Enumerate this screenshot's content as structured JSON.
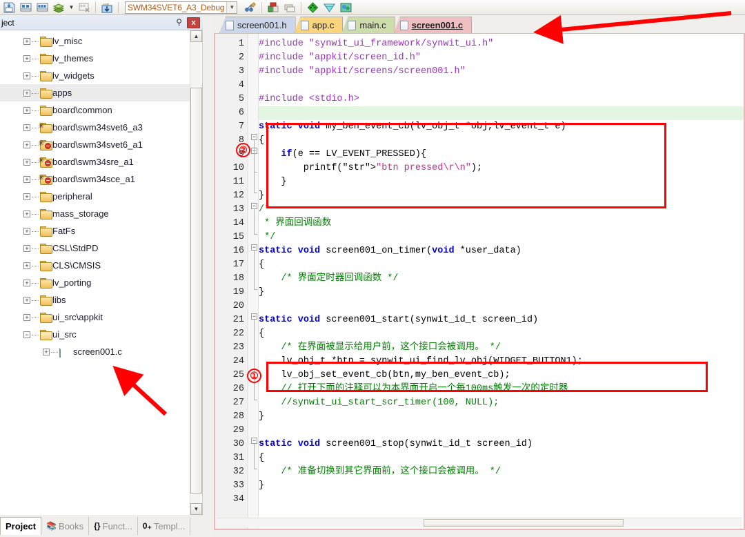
{
  "toolbar": {
    "icons": [
      "save-all-icon",
      "insert-bookmark-icon",
      "next-bookmark-icon",
      "layers-icon",
      "clear-bookmarks-icon",
      "debug-icon",
      "target-options-icon",
      "manage-components-icon",
      "pack-installer-icon",
      "configuration-wizard-icon",
      "events-viewer-icon"
    ],
    "config_value": "SWM34SVET6_A3_Debug",
    "dropdown_icon": "chevron-down-icon"
  },
  "left_panel": {
    "title": "ject",
    "pin_icon": "pin-icon",
    "close_label": "x",
    "scroll_up_icon": "▲",
    "scroll_down_icon": "▼",
    "tree": [
      {
        "label": "lv_misc",
        "type": "folder",
        "expander": "+",
        "depth": 0,
        "selected": false,
        "badge": "none"
      },
      {
        "label": "lv_themes",
        "type": "folder",
        "expander": "+",
        "depth": 0,
        "selected": false,
        "badge": "none"
      },
      {
        "label": "lv_widgets",
        "type": "folder",
        "expander": "+",
        "depth": 0,
        "selected": false,
        "badge": "none"
      },
      {
        "label": "apps",
        "type": "folder",
        "expander": "+",
        "depth": 0,
        "selected": true,
        "badge": "none"
      },
      {
        "label": "board\\common",
        "type": "folder",
        "expander": "+",
        "depth": 0,
        "selected": false,
        "badge": "none"
      },
      {
        "label": "board\\swm34svet6_a3",
        "type": "folder",
        "expander": "+",
        "depth": 0,
        "selected": false,
        "badge": "gear"
      },
      {
        "label": "board\\swm34svet6_a1",
        "type": "folder",
        "expander": "+",
        "depth": 0,
        "selected": false,
        "badge": "gear-excluded"
      },
      {
        "label": "board\\swm34sre_a1",
        "type": "folder",
        "expander": "+",
        "depth": 0,
        "selected": false,
        "badge": "gear-excluded"
      },
      {
        "label": "board\\swm34sce_a1",
        "type": "folder",
        "expander": "+",
        "depth": 0,
        "selected": false,
        "badge": "gear-excluded"
      },
      {
        "label": "peripheral",
        "type": "folder",
        "expander": "+",
        "depth": 0,
        "selected": false,
        "badge": "none"
      },
      {
        "label": "mass_storage",
        "type": "folder",
        "expander": "+",
        "depth": 0,
        "selected": false,
        "badge": "none"
      },
      {
        "label": "FatFs",
        "type": "folder",
        "expander": "+",
        "depth": 0,
        "selected": false,
        "badge": "none"
      },
      {
        "label": "CSL\\StdPD",
        "type": "folder",
        "expander": "+",
        "depth": 0,
        "selected": false,
        "badge": "none"
      },
      {
        "label": "CLS\\CMSIS",
        "type": "folder",
        "expander": "+",
        "depth": 0,
        "selected": false,
        "badge": "none"
      },
      {
        "label": "lv_porting",
        "type": "folder",
        "expander": "+",
        "depth": 0,
        "selected": false,
        "badge": "none"
      },
      {
        "label": "libs",
        "type": "folder",
        "expander": "+",
        "depth": 0,
        "selected": false,
        "badge": "none"
      },
      {
        "label": "ui_src\\appkit",
        "type": "folder",
        "expander": "+",
        "depth": 0,
        "selected": false,
        "badge": "none"
      },
      {
        "label": "ui_src",
        "type": "folder-open",
        "expander": "−",
        "depth": 0,
        "selected": false,
        "badge": "none"
      },
      {
        "label": "screen001.c",
        "type": "file",
        "expander": "+",
        "depth": 1,
        "selected": false,
        "badge": "none"
      }
    ]
  },
  "bottom_tabs": [
    {
      "label": "Project",
      "icon": "",
      "active": true
    },
    {
      "label": "Books",
      "icon": "books-icon",
      "active": false
    },
    {
      "label": "Funct...",
      "icon": "{}",
      "active": false
    },
    {
      "label": "Templ...",
      "icon": "0+",
      "active": false
    }
  ],
  "editor": {
    "file_tabs": [
      {
        "label": "screen001.h",
        "color": "#ccd6ea",
        "active": false
      },
      {
        "label": "app.c",
        "color": "#fbd57e",
        "active": false
      },
      {
        "label": "main.c",
        "color": "#cddcab",
        "active": false
      },
      {
        "label": "screen001.c",
        "color": "#f0bfc2",
        "active": true
      }
    ],
    "code_lines": [
      {
        "n": 1,
        "text": "#include \"synwit_ui_framework/synwit_ui.h\"",
        "style": "pp"
      },
      {
        "n": 2,
        "text": "#include \"appkit/screen_id.h\"",
        "style": "pp"
      },
      {
        "n": 3,
        "text": "#include \"appkit/screens/screen001.h\"",
        "style": "pp"
      },
      {
        "n": 4,
        "text": "",
        "style": "plain"
      },
      {
        "n": 5,
        "text": "#include <stdio.h>",
        "style": "pp"
      },
      {
        "n": 6,
        "text": "",
        "style": "plain",
        "highlight": true
      },
      {
        "n": 7,
        "text": "static void my_ben_event_cb(lv_obj_t *obj,lv_event_t e)",
        "style": "mixed-decl"
      },
      {
        "n": 8,
        "text": "{",
        "style": "plain"
      },
      {
        "n": 9,
        "text": "    if(e == LV_EVENT_PRESSED){",
        "style": "mixed-if"
      },
      {
        "n": 10,
        "text": "        printf(\"btn pressed\\r\\n\");",
        "style": "mixed-printf"
      },
      {
        "n": 11,
        "text": "    }",
        "style": "plain"
      },
      {
        "n": 12,
        "text": "}",
        "style": "plain"
      },
      {
        "n": 13,
        "text": "/*",
        "style": "cmt"
      },
      {
        "n": 14,
        "text": " * 界面回调函数",
        "style": "cmt"
      },
      {
        "n": 15,
        "text": " */",
        "style": "cmt"
      },
      {
        "n": 16,
        "text": "static void screen001_on_timer(void *user_data)",
        "style": "mixed-timer"
      },
      {
        "n": 17,
        "text": "{",
        "style": "plain"
      },
      {
        "n": 18,
        "text": "    /* 界面定时器回调函数 */",
        "style": "cmt"
      },
      {
        "n": 19,
        "text": "}",
        "style": "plain"
      },
      {
        "n": 20,
        "text": "",
        "style": "plain"
      },
      {
        "n": 21,
        "text": "static void screen001_start(synwit_id_t screen_id)",
        "style": "mixed-start"
      },
      {
        "n": 22,
        "text": "{",
        "style": "plain"
      },
      {
        "n": 23,
        "text": "    /* 在界面被显示给用户前，这个接口会被调用。 */",
        "style": "cmt"
      },
      {
        "n": 24,
        "text": "    lv_obj_t *btn = synwit_ui_find_lv_obj(WIDGET_BUTTON1);",
        "style": "plain"
      },
      {
        "n": 25,
        "text": "    lv_obj_set_event_cb(btn,my_ben_event_cb);",
        "style": "plain"
      },
      {
        "n": 26,
        "text": "    // 打开下面的注释可以为本界面开启一个每100ms触发一次的定时器",
        "style": "cmt"
      },
      {
        "n": 27,
        "text": "    //synwit_ui_start_scr_timer(100, NULL);",
        "style": "cmt"
      },
      {
        "n": 28,
        "text": "}",
        "style": "plain"
      },
      {
        "n": 29,
        "text": "",
        "style": "plain"
      },
      {
        "n": 30,
        "text": "static void screen001_stop(synwit_id_t screen_id)",
        "style": "mixed-stop"
      },
      {
        "n": 31,
        "text": "{",
        "style": "plain"
      },
      {
        "n": 32,
        "text": "    /* 准备切换到其它界面前，这个接口会被调用。 */",
        "style": "cmt"
      },
      {
        "n": 33,
        "text": "}",
        "style": "plain"
      },
      {
        "n": 34,
        "text": "",
        "style": "plain"
      }
    ]
  },
  "annotations": {
    "marker_1": "①",
    "marker_2": "②",
    "accent_color": "#ff0000",
    "boxes": [
      {
        "name": "callback-function-box",
        "lines": "7-12"
      },
      {
        "name": "event-binding-box",
        "lines": "24-25"
      }
    ],
    "arrows": [
      {
        "name": "arrow-to-active-tab",
        "target": "screen001.c tab"
      },
      {
        "name": "arrow-to-tree-file",
        "target": "screen001.c tree node"
      }
    ]
  }
}
